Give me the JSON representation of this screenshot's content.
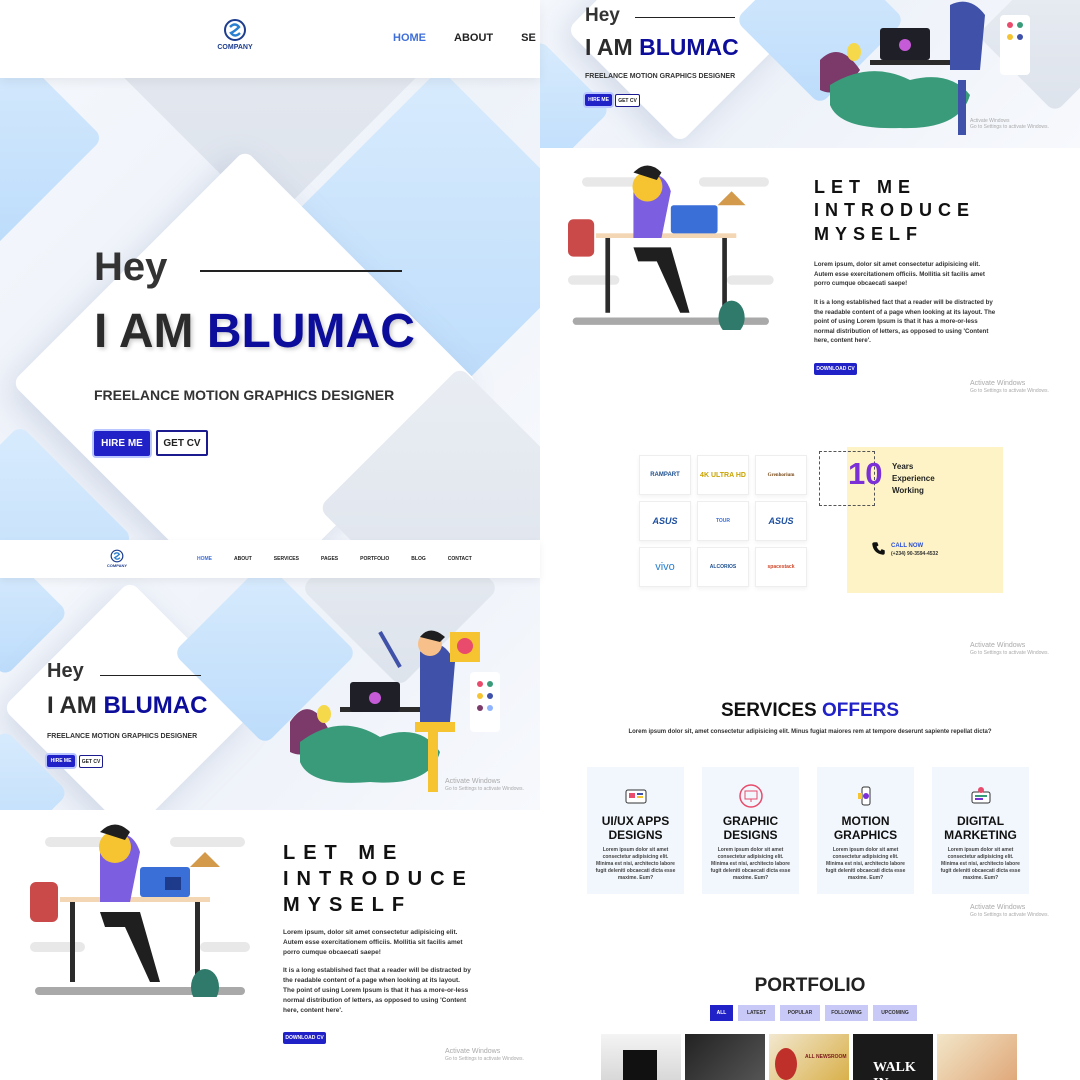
{
  "hero_main": {
    "company": "COMPANY",
    "nav": [
      "HOME",
      "ABOUT",
      "SE"
    ],
    "greeting": "Hey",
    "title_prefix": "I AM",
    "title_name": "BLUMAC",
    "subtitle": "FREELANCE MOTION GRAPHICS DESIGNER",
    "hire_label": "HIRE ME",
    "cv_label": "GET CV"
  },
  "hero_small": {
    "company": "COMPANY",
    "nav": [
      "HOME",
      "ABOUT",
      "SERVICES",
      "PAGES",
      "PORTFOLIO",
      "BLOG",
      "CONTACT"
    ],
    "greeting": "Hey",
    "title_prefix": "I AM",
    "title_name": "BLUMAC",
    "subtitle": "FREELANCE MOTION GRAPHICS DESIGNER",
    "hire_label": "HIRE ME",
    "cv_label": "GET CV"
  },
  "hero_top_right": {
    "greeting": "Hey",
    "title_prefix": "I AM",
    "title_name": "BLUMAC",
    "subtitle": "FREELANCE MOTION GRAPHICS DESIGNER",
    "hire_label": "HIRE ME",
    "cv_label": "GET CV"
  },
  "introduce": {
    "title_lines": [
      "LET ME",
      "INTRODUCE",
      "MYSELF"
    ],
    "paragraph1": "Lorem ipsum, dolor sit amet consectetur adipisicing elit. Autem esse exercitationem officiis. Mollitia sit facilis amet porro cumque obcaecati saepe!",
    "paragraph2": "It is a long established fact that a reader will be distracted by the readable content of a page when looking at its layout. The point of using Lorem Ipsum is that it has a more-or-less normal distribution of letters, as opposed to using 'Content here, content here'.",
    "download_label": "DOWNLOAD CV"
  },
  "clients": {
    "logos": [
      "RAMPART",
      "4K ULTRA HD",
      "Grenhorium",
      "ASUS",
      "TOUR",
      "ASUS",
      "vivo",
      "ALCORIOS",
      "spacestack"
    ]
  },
  "experience": {
    "years": "10",
    "label_lines": [
      "Years",
      "Experience",
      "Working"
    ],
    "call_label": "CALL NOW",
    "phone": "(+234) 90-3594-4532"
  },
  "services": {
    "title_prefix": "SERVICES",
    "title_highlight": "OFFERS",
    "subtitle": "Lorem ipsum dolor sit, amet consectetur adipisicing elit. Minus fugiat maiores rem at tempore deserunt sapiente repellat dicta?",
    "cards": [
      {
        "title_lines": [
          "UI/UX APPS",
          "DESIGNS"
        ],
        "icon": "ui-ux-icon",
        "text": "Lorem ipsum dolor sit amet consectetur adipisicing elit. Minima est nisi, architecto labore fugit deleniti obcaecati dicta esse maxime. Eum?"
      },
      {
        "title_lines": [
          "GRAPHIC",
          "DESIGNS"
        ],
        "icon": "graphic-monitor-icon",
        "text": "Lorem ipsum dolor sit amet consectetur adipisicing elit. Minima est nisi, architecto labore fugit deleniti obcaecati dicta esse maxime. Eum?"
      },
      {
        "title_lines": [
          "MOTION",
          "GRAPHICS"
        ],
        "icon": "motion-icon",
        "text": "Lorem ipsum dolor sit amet consectetur adipisicing elit. Minima est nisi, architecto labore fugit deleniti obcaecati dicta esse maxime. Eum?"
      },
      {
        "title_lines": [
          "DIGITAL",
          "MARKETING"
        ],
        "icon": "marketing-icon",
        "text": "Lorem ipsum dolor sit amet consectetur adipisicing elit. Minima est nisi, architecto labore fugit deleniti obcaecati dicta esse maxime. Eum?"
      }
    ]
  },
  "portfolio": {
    "title": "PORTFOLIO",
    "filters": [
      "ALL",
      "LATEST",
      "POPULAR",
      "FOLLOWING",
      "UPCOMING"
    ],
    "thumb_texts": [
      "",
      "",
      "ALL NEWSROOM",
      "WALK IN"
    ]
  },
  "watermark": {
    "line1": "Activate Windows",
    "line2": "Go to Settings to activate Windows."
  },
  "colors": {
    "accent": "#0d0d9c",
    "button": "#2121c8",
    "highlight_box": "#fdf3c6",
    "purple": "#7b2fd6"
  }
}
